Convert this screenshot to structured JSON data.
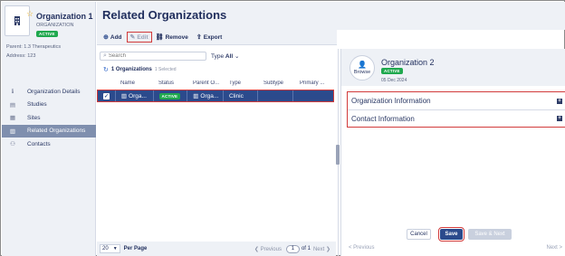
{
  "org": {
    "name": "Organization 1",
    "type": "ORGANIZATION",
    "status": "ACTIVE",
    "parent": "Parent: 1.3 Therapeutics",
    "address": "Address: 123"
  },
  "nav": [
    {
      "label": "Organization Details",
      "icon": "info-icon"
    },
    {
      "label": "Studies",
      "icon": "book-icon"
    },
    {
      "label": "Sites",
      "icon": "sites-icon"
    },
    {
      "label": "Related Organizations",
      "icon": "building-icon",
      "active": true
    },
    {
      "label": "Contacts",
      "icon": "people-icon"
    }
  ],
  "page": {
    "title": "Related Organizations"
  },
  "toolbar": {
    "add": "Add",
    "edit": "Edit",
    "remove": "Remove",
    "export": "Export"
  },
  "search": {
    "placeholder": "Search"
  },
  "filter": {
    "label": "Type",
    "value": "All"
  },
  "selection": {
    "count": "1 Organizations",
    "selected": "1 Selected"
  },
  "grid": {
    "headers": [
      "Name",
      "Status",
      "Parent O...",
      "Type",
      "Subtype",
      "Primary ..."
    ],
    "rows": [
      {
        "name": "Orga...",
        "status": "ACTIVE",
        "parent": "Orga...",
        "type": "Clinic",
        "subtype": "",
        "primary": ""
      }
    ]
  },
  "pager": {
    "page_size": "20",
    "per_page": "Per Page",
    "previous": "Previous",
    "page": "1",
    "of": "of 1",
    "next": "Next"
  },
  "detail": {
    "name": "Organization 2",
    "status": "ACTIVE",
    "date": "05 Dec 2024",
    "browse": "Browse",
    "sections": [
      "Organization Information",
      "Contact Information"
    ],
    "cancel": "Cancel",
    "save": "Save",
    "save_next": "Save & Next",
    "previous": "< Previous",
    "next": "Next >"
  },
  "colors": {
    "primary": "#2b4a8c",
    "active_badge": "#1fa84e",
    "highlight": "#d23b3b",
    "sidebar_bg": "#eef1f6"
  }
}
